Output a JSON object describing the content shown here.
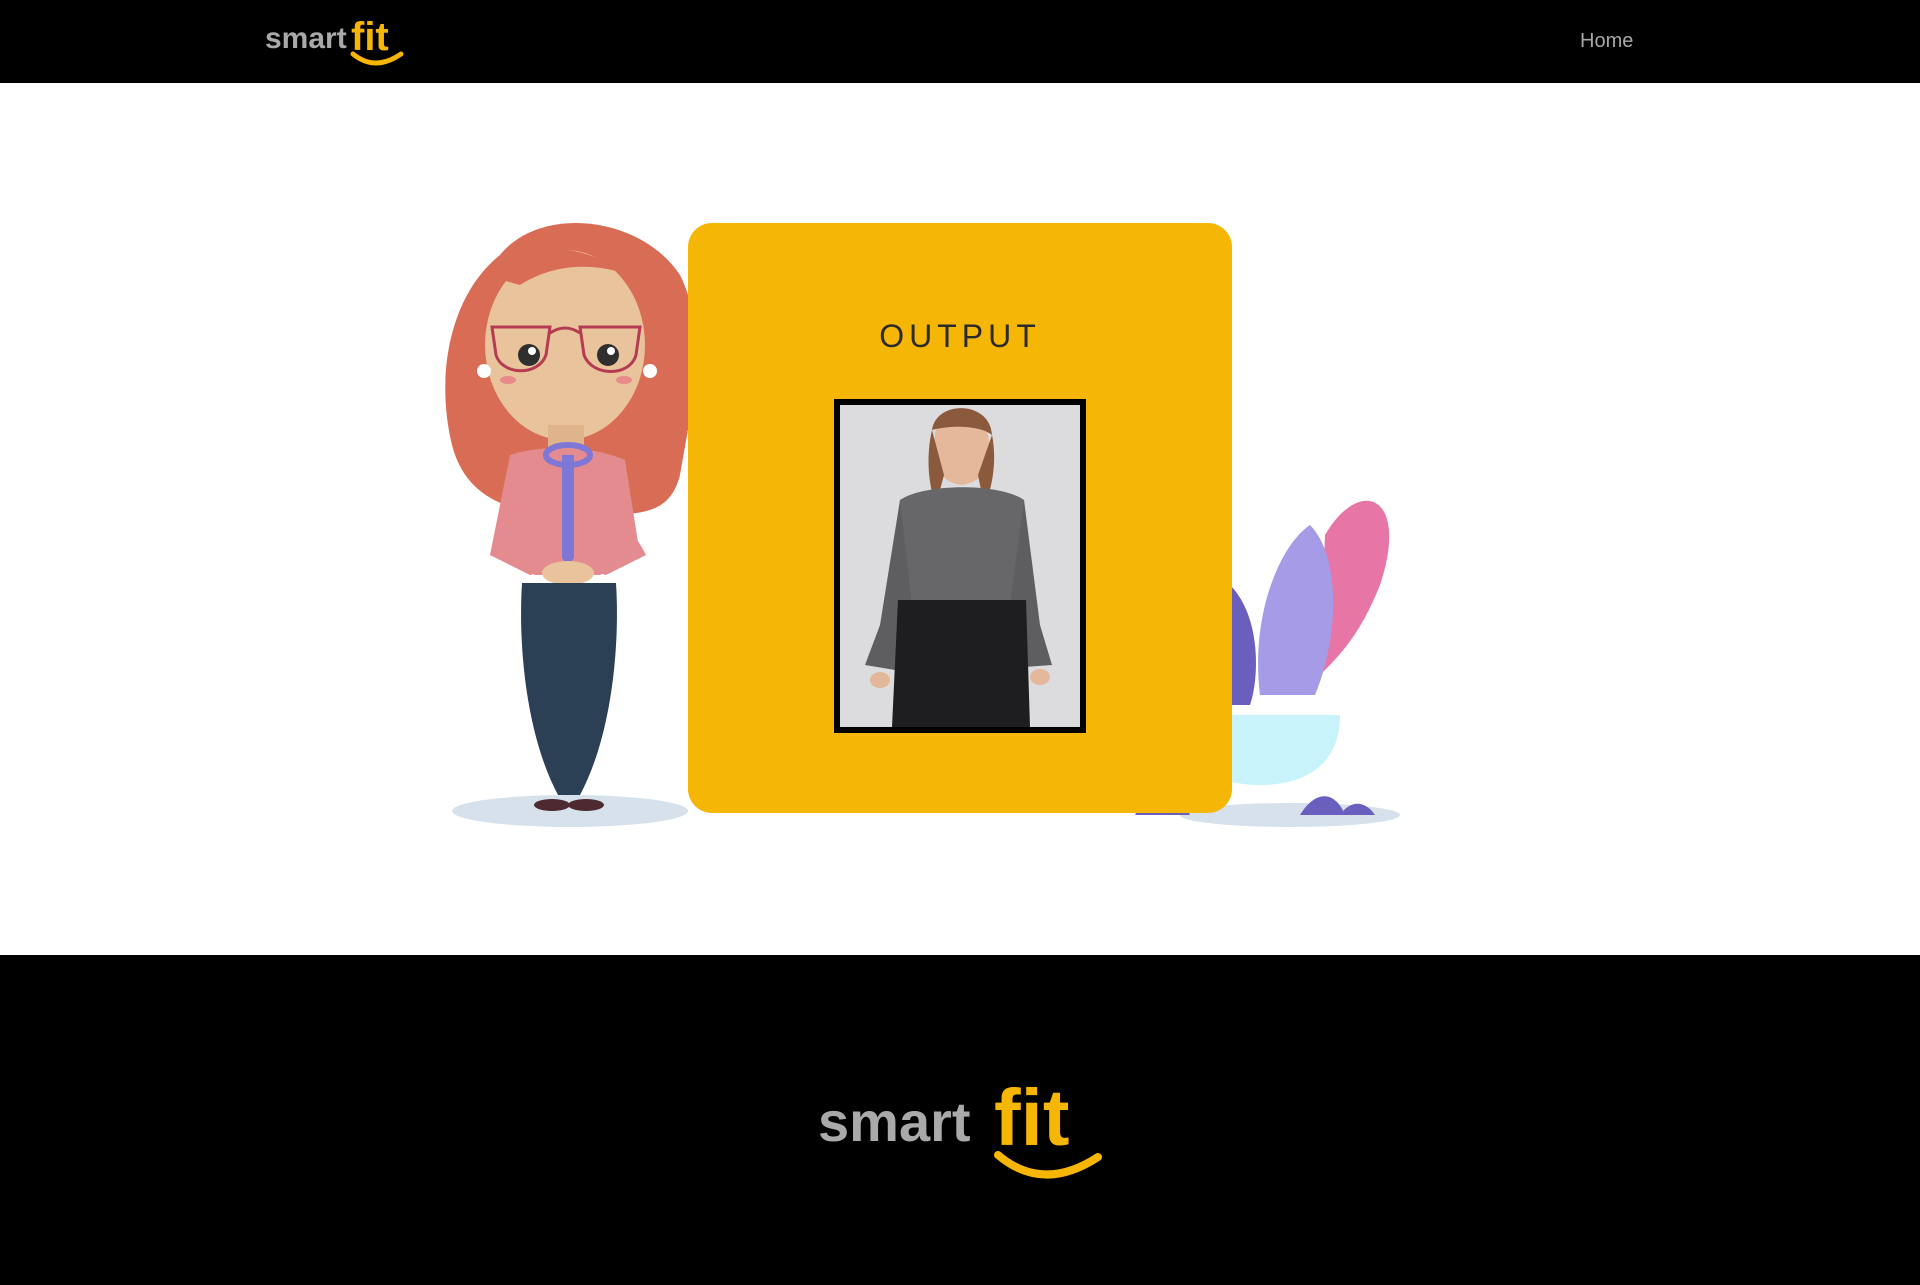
{
  "header": {
    "logo": {
      "text_left": "smart",
      "text_right": "fit"
    },
    "nav": {
      "home_label": "Home"
    }
  },
  "card": {
    "title": "OUTPUT",
    "image_alt": "person-wearing-grey-top-and-black-skirt-icon"
  },
  "footer": {
    "logo": {
      "text_left": "smart",
      "text_right": "fit"
    }
  },
  "colors": {
    "bar": "#000000",
    "accent_yellow": "#f6b605",
    "logo_grey": "#a9a9a9",
    "nav_text": "#a7a7a7"
  }
}
